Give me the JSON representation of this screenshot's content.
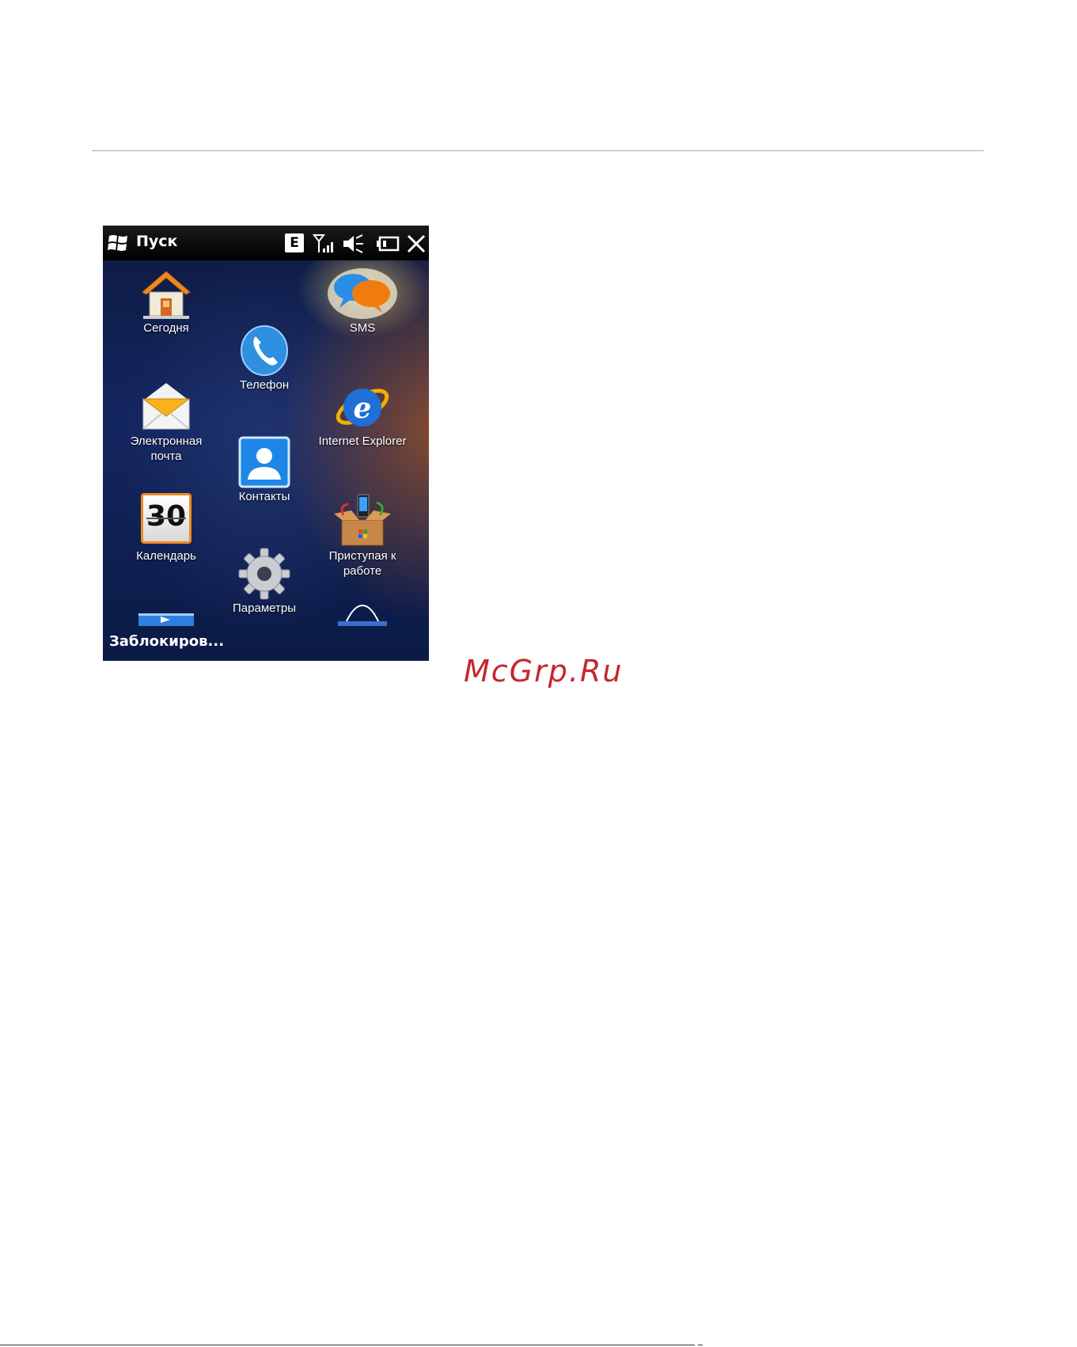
{
  "titlebar": {
    "title": "Пуск",
    "start_icon": "windows-flag-icon",
    "status": {
      "network_type": "E",
      "icons": [
        "network-edge-icon",
        "signal-strength-icon",
        "volume-muted-icon",
        "battery-icon",
        "close-icon"
      ]
    }
  },
  "apps": [
    {
      "label": "Сегодня",
      "icon": "home-icon"
    },
    {
      "label": "Телефон",
      "icon": "phone-icon"
    },
    {
      "label": "SMS",
      "icon": "sms-icon"
    },
    {
      "label": "Электронная почта",
      "icon": "email-icon"
    },
    {
      "label": "Контакты",
      "icon": "contacts-icon"
    },
    {
      "label": "Internet Explorer",
      "icon": "internet-explorer-icon"
    },
    {
      "label": "30",
      "icon": "calendar-icon"
    },
    {
      "label": "Календарь",
      "icon": "calendar-icon"
    },
    {
      "label": "Параметры",
      "icon": "settings-gear-icon"
    },
    {
      "label": "Приступая к работе",
      "icon": "getting-started-icon"
    }
  ],
  "softkey": {
    "left_label": "Заблокиров..."
  },
  "watermark": "McGrp.Ru",
  "colors": {
    "titlebar": "#000000",
    "background_top": "#0d1a40",
    "watermark": "#c6262e"
  }
}
